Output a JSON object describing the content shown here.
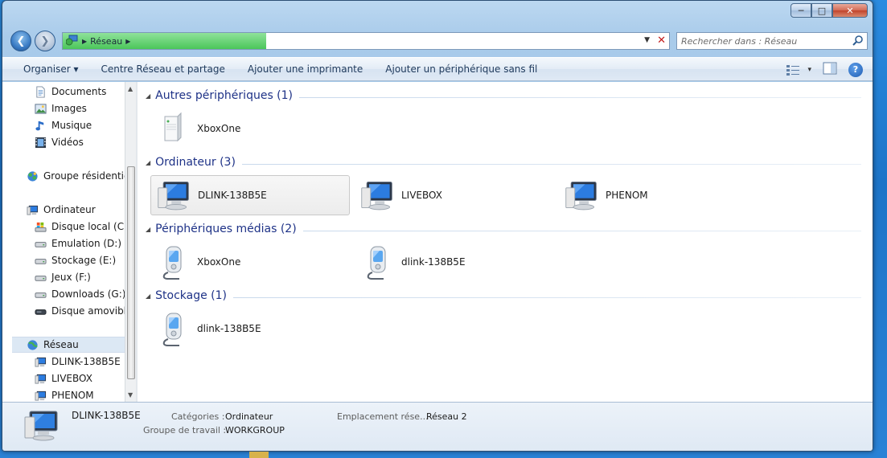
{
  "window": {
    "caption_buttons": {
      "minimize": "─",
      "maximize": "□",
      "close": "✕"
    }
  },
  "address_bar": {
    "separator": "▶",
    "crumb": "Réseau",
    "load_progress": 0.335,
    "progress_color": "#4bc65a"
  },
  "search": {
    "placeholder": "Rechercher dans : Réseau"
  },
  "toolbar": {
    "organize": "Organiser ▾",
    "items": [
      "Centre Réseau et partage",
      "Ajouter une imprimante",
      "Ajouter un périphérique sans fil"
    ],
    "view_dropdown": "▾",
    "help": "?"
  },
  "nav_pane": {
    "items": [
      {
        "label": "Documents",
        "icon": "document-icon"
      },
      {
        "label": "Images",
        "icon": "image-icon"
      },
      {
        "label": "Musique",
        "icon": "music-icon"
      },
      {
        "label": "Vidéos",
        "icon": "video-icon"
      },
      {
        "label": "Groupe résidentiel",
        "icon": "homegroup-icon"
      },
      {
        "label": "Ordinateur",
        "icon": "computer-icon"
      },
      {
        "label": "Disque local (C:)",
        "icon": "system-drive-icon"
      },
      {
        "label": "Emulation (D:)",
        "icon": "drive-icon"
      },
      {
        "label": "Stockage (E:)",
        "icon": "drive-icon"
      },
      {
        "label": "Jeux (F:)",
        "icon": "drive-icon"
      },
      {
        "label": "Downloads (G:)",
        "icon": "drive-icon"
      },
      {
        "label": "Disque amovible",
        "icon": "removable-drive-icon"
      },
      {
        "label": "Réseau",
        "icon": "network-icon",
        "selected": true
      },
      {
        "label": "DLINK-138B5E",
        "icon": "computer-icon"
      },
      {
        "label": "LIVEBOX",
        "icon": "computer-icon"
      },
      {
        "label": "PHENOM",
        "icon": "computer-icon"
      }
    ],
    "scroll_up": "▲",
    "scroll_down": "▼"
  },
  "groups": [
    {
      "title": "Autres périphériques (1)",
      "items": [
        {
          "label": "XboxOne",
          "icon": "device-icon"
        }
      ]
    },
    {
      "title": "Ordinateur (3)",
      "items": [
        {
          "label": "DLINK-138B5E",
          "icon": "computer-icon",
          "selected": true
        },
        {
          "label": "LIVEBOX",
          "icon": "computer-icon"
        },
        {
          "label": "PHENOM",
          "icon": "computer-icon"
        }
      ]
    },
    {
      "title": "Périphériques médias (2)",
      "items": [
        {
          "label": "XboxOne",
          "icon": "media-device-icon"
        },
        {
          "label": "dlink-138B5E",
          "icon": "media-device-icon"
        }
      ]
    },
    {
      "title": "Stockage (1)",
      "items": [
        {
          "label": "dlink-138B5E",
          "icon": "media-device-icon"
        }
      ]
    }
  ],
  "details": {
    "name": "DLINK-138B5E",
    "categories_label": "Catégories :",
    "categories_value": "Ordinateur",
    "workgroup_label": "Groupe de travail :",
    "workgroup_value": "WORKGROUP",
    "location_label": "Emplacement rése...",
    "location_value": "Réseau  2"
  },
  "colors": {
    "accent": "#1e3287",
    "selection": "#dce8f4",
    "window_frame": "#a9cbea"
  }
}
